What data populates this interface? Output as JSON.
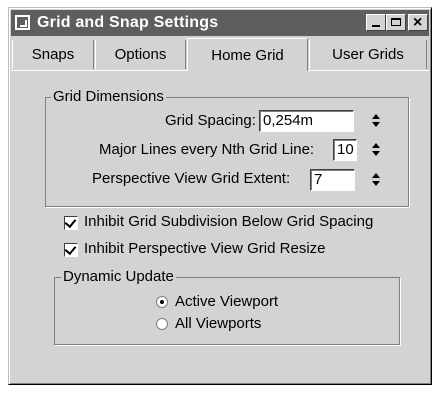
{
  "window": {
    "title": "Grid and Snap Settings"
  },
  "tabs": [
    {
      "label": "Snaps"
    },
    {
      "label": "Options"
    },
    {
      "label": "Home Grid"
    },
    {
      "label": "User Grids"
    }
  ],
  "active_tab": "Home Grid",
  "grid_dimensions": {
    "legend": "Grid Dimensions",
    "spacing_label": "Grid Spacing:",
    "spacing_value": "0,254m",
    "major_lines_label": "Major Lines every Nth Grid Line:",
    "major_lines_value": "10",
    "perspective_extent_label": "Perspective View Grid Extent:",
    "perspective_extent_value": "7"
  },
  "options": {
    "inhibit_subdivision_label": "Inhibit Grid Subdivision Below Grid Spacing",
    "inhibit_subdivision_checked": true,
    "inhibit_resize_label": "Inhibit Perspective View Grid Resize",
    "inhibit_resize_checked": true
  },
  "dynamic_update": {
    "legend": "Dynamic Update",
    "active_viewport_label": "Active Viewport",
    "all_viewports_label": "All Viewports",
    "selected": "Active Viewport"
  }
}
